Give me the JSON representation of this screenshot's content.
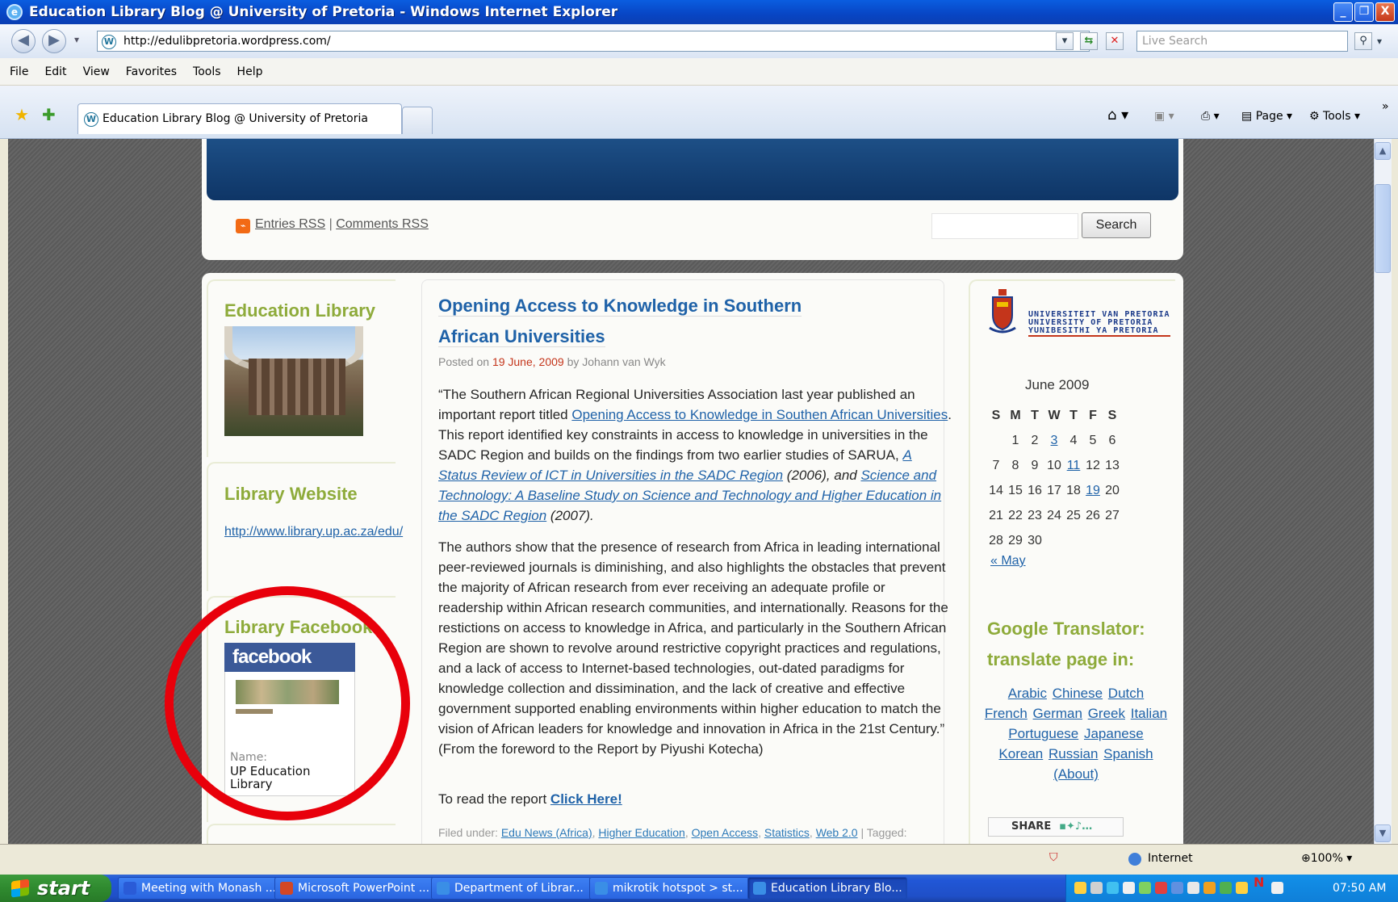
{
  "window": {
    "title": "Education Library Blog @ University of Pretoria - Windows Internet Explorer",
    "minimize": "_",
    "maximize": "❐",
    "close": "X"
  },
  "nav": {
    "address": "http://edulibpretoria.wordpress.com/",
    "search_placeholder": "Live Search",
    "back": "◀",
    "forward": "▶"
  },
  "menu": {
    "items": [
      "File",
      "Edit",
      "View",
      "Favorites",
      "Tools",
      "Help"
    ]
  },
  "tabs": {
    "active": "Education Library Blog @ University of Pretoria"
  },
  "commandbar": {
    "page": "Page ▾",
    "tools": "Tools ▾",
    "more": "»"
  },
  "blog": {
    "rss_entries": "Entries RSS",
    "rss_separator": " | ",
    "rss_comments": "Comments RSS",
    "search_button": "Search",
    "sidebar_left": {
      "education_library_title": "Education Library",
      "library_website_title": "Library Website",
      "library_website_link": "http://www.library.up.ac.za/edu/",
      "facebook_title": "Library Facebook",
      "facebook_logo": "facebook",
      "facebook_name_label": "Name:",
      "facebook_name_value": "UP Education Library"
    },
    "post": {
      "title_line1": "Opening Access to Knowledge in Southern",
      "title_line2": "African Universities",
      "meta_prefix": "Posted on ",
      "meta_date": "19 June, 2009",
      "meta_by": " by Johann van Wyk",
      "p1_a": "“The Southern African Regional Universities Association last year published an important report titled ",
      "p1_link1": "Opening Access to Knowledge in Southen African Universities",
      "p1_b": ". This report identified key constraints in access to knowledge in universities in the SADC Region and builds on the findings from two earlier studies of  SARUA, ",
      "p1_link2": "A Status Review of ICT in Universities in the SADC Region",
      "p1_c": " (2006), and ",
      "p1_link3": "Science and Technology: A Baseline Study on Science and Technology and Higher Education in the SADC Region",
      "p1_d": " (2007).",
      "p2": "The authors show that the presence of research from Africa in leading international peer-reviewed journals is diminishing, and also highlights the obstacles that prevent the majority of African research from ever receiving an adequate profile or readership within African research communities, and internationally. Reasons for the restictions on access to knowledge in Africa, and particularly in the Southern African Region are shown to revolve around restrictive copyright practices and regulations, and a lack of access to Internet-based technologies, out-dated paradigms for knowledge collection and dissimination, and the lack of creative and effective government supported enabling environments within higher education to match the vision of African leaders for knowledge and innovation in Africa in the 21st Century.” (From the foreword to the Report by Piyushi Kotecha)",
      "read_prefix": "To read the report ",
      "read_link": "Click Here!",
      "filed_prefix": "Filed under: ",
      "filed_tags": [
        "Edu News (Africa)",
        "Higher Education",
        "Open Access",
        "Statistics",
        "Web 2.0"
      ],
      "filed_suffix": " | Tagged:"
    },
    "sidebar_right": {
      "university_lines": [
        "UNIVERSITEIT VAN PRETORIA",
        "UNIVERSITY OF PRETORIA",
        "YUNIBESITHI YA PRETORIA"
      ],
      "calendar_caption": "June 2009",
      "calendar_days": [
        "S",
        "M",
        "T",
        "W",
        "T",
        "F",
        "S"
      ],
      "calendar_rows": [
        [
          "",
          "1",
          "2",
          "3",
          "4",
          "5",
          "6"
        ],
        [
          "7",
          "8",
          "9",
          "10",
          "11",
          "12",
          "13"
        ],
        [
          "14",
          "15",
          "16",
          "17",
          "18",
          "19",
          "20"
        ],
        [
          "21",
          "22",
          "23",
          "24",
          "25",
          "26",
          "27"
        ],
        [
          "28",
          "29",
          "30",
          "",
          "",
          "",
          ""
        ]
      ],
      "calendar_linked": [
        "3",
        "11",
        "19"
      ],
      "calendar_prev": "« May",
      "translator_title": "Google Translator: translate page in:",
      "languages": [
        "Arabic",
        "Chinese",
        "Dutch",
        "French",
        "German",
        "Greek",
        "Italian",
        "Portuguese",
        "Japanese",
        "Korean",
        "Russian",
        "Spanish"
      ],
      "about": "(About)",
      "share": "SHARE"
    }
  },
  "status": {
    "zone": "Internet",
    "zoom": "100%"
  },
  "taskbar": {
    "start": "start",
    "tasks": [
      {
        "label": "Meeting with Monash ...",
        "icon": "word-icon",
        "color": "#2a5bd7"
      },
      {
        "label": "Microsoft PowerPoint ...",
        "icon": "powerpoint-icon",
        "color": "#d24726"
      },
      {
        "label": "Department of Librar...",
        "icon": "ie-icon",
        "color": "#3a8ee6"
      },
      {
        "label": "mikrotik hotspot > st...",
        "icon": "ie-icon",
        "color": "#3a8ee6"
      },
      {
        "label": "Education Library Blo...",
        "icon": "ie-icon",
        "color": "#3a8ee6"
      }
    ],
    "clock": "07:50 AM"
  },
  "colors": {
    "accent_green": "#8eab3b",
    "link_blue": "#1f62a8",
    "facebook_blue": "#3b5998",
    "annotation_red": "#e8000b"
  }
}
